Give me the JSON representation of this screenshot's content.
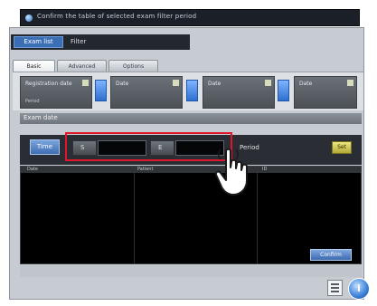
{
  "window": {
    "title": "Confirm the table of selected exam filter period"
  },
  "header": {
    "badge_label": "Exam list",
    "title": "Filter"
  },
  "tabs": [
    {
      "label": "Basic"
    },
    {
      "label": "Advanced"
    },
    {
      "label": "Options"
    }
  ],
  "cards": [
    {
      "title": "Registration date",
      "sub": "Period"
    },
    {
      "title": "Date",
      "sub": ""
    },
    {
      "title": "Date",
      "sub": ""
    },
    {
      "title": "Date",
      "sub": ""
    }
  ],
  "section": {
    "title": "Exam date"
  },
  "filter": {
    "time_button": "Time",
    "from_label": "S",
    "to_label": "E",
    "from_value": "",
    "to_value": "",
    "right_label": "Period",
    "yellow_button": "Set"
  },
  "table": {
    "columns": [
      "Date",
      "Patient",
      "ID"
    ]
  },
  "ok_button": "Confirm",
  "colors": {
    "highlight": "#e0162b",
    "accent_blue": "#3b6fb5",
    "yellow": "#e5df6e"
  },
  "icons": [
    "info-icon",
    "list-icon",
    "touch-hand-icon"
  ]
}
